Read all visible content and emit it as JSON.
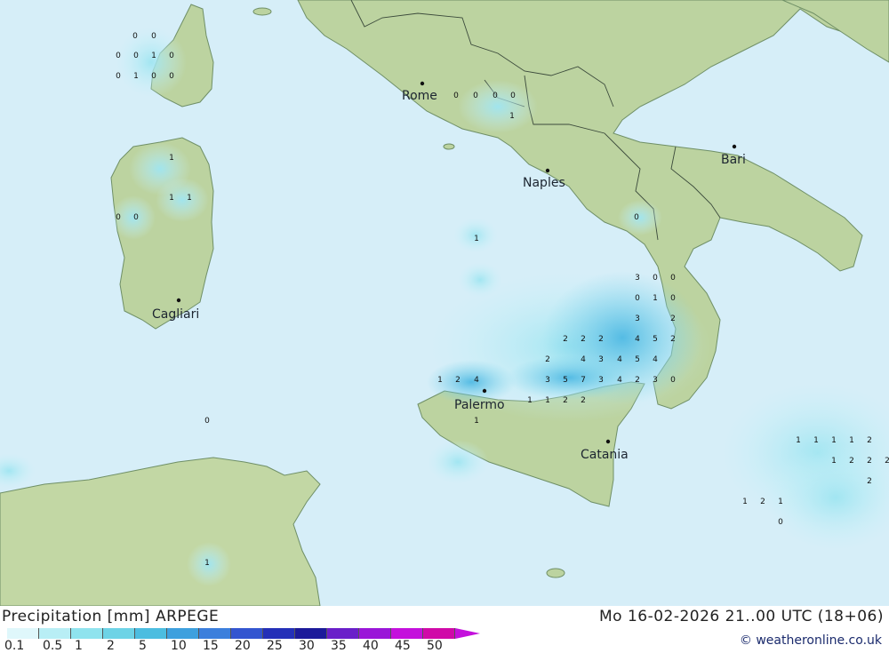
{
  "map": {
    "cities": [
      "Rome",
      "Naples",
      "Bari",
      "Cagliari",
      "Palermo",
      "Catania"
    ]
  },
  "values": [
    {
      "id": "v1",
      "t": "0"
    },
    {
      "id": "v2",
      "t": "0"
    },
    {
      "id": "v3",
      "t": "0"
    },
    {
      "id": "v4",
      "t": "0"
    },
    {
      "id": "v5",
      "t": "1"
    },
    {
      "id": "v6",
      "t": "0"
    },
    {
      "id": "v7",
      "t": "0"
    },
    {
      "id": "v8",
      "t": "1"
    },
    {
      "id": "v9",
      "t": "0"
    },
    {
      "id": "v10",
      "t": "0"
    },
    {
      "id": "v11",
      "t": "0"
    },
    {
      "id": "v12",
      "t": "0"
    },
    {
      "id": "v13",
      "t": "0"
    },
    {
      "id": "v14",
      "t": "0"
    },
    {
      "id": "v15",
      "t": "1"
    },
    {
      "id": "v16",
      "t": "1"
    },
    {
      "id": "v17",
      "t": "1"
    },
    {
      "id": "v18",
      "t": "1"
    },
    {
      "id": "v19",
      "t": "0"
    },
    {
      "id": "v20",
      "t": "0"
    },
    {
      "id": "v21",
      "t": "1"
    },
    {
      "id": "v22",
      "t": "0"
    },
    {
      "id": "v23",
      "t": "0"
    },
    {
      "id": "v24",
      "t": "0"
    },
    {
      "id": "v25",
      "t": "0"
    },
    {
      "id": "v26",
      "t": "1"
    },
    {
      "id": "v27",
      "t": "0"
    },
    {
      "id": "v28",
      "t": "2"
    },
    {
      "id": "v29",
      "t": "2"
    },
    {
      "id": "v30",
      "t": "2"
    },
    {
      "id": "v31",
      "t": "4"
    },
    {
      "id": "v32",
      "t": "5"
    },
    {
      "id": "v33",
      "t": "2"
    },
    {
      "id": "v34",
      "t": "2"
    },
    {
      "id": "v35",
      "t": "4"
    },
    {
      "id": "v36",
      "t": "3"
    },
    {
      "id": "v37",
      "t": "4"
    },
    {
      "id": "v38",
      "t": "5"
    },
    {
      "id": "v39",
      "t": "4"
    },
    {
      "id": "v40",
      "t": "1"
    },
    {
      "id": "v41",
      "t": "2"
    },
    {
      "id": "v42",
      "t": "4"
    },
    {
      "id": "v43",
      "t": "3"
    },
    {
      "id": "v44",
      "t": "5"
    },
    {
      "id": "v45",
      "t": "7"
    },
    {
      "id": "v46",
      "t": "3"
    },
    {
      "id": "v47",
      "t": "4"
    },
    {
      "id": "v48",
      "t": "2"
    },
    {
      "id": "v49",
      "t": "3"
    },
    {
      "id": "v50",
      "t": "0"
    },
    {
      "id": "v51",
      "t": "1"
    },
    {
      "id": "v52",
      "t": "1"
    },
    {
      "id": "v53",
      "t": "2"
    },
    {
      "id": "v54",
      "t": "2"
    },
    {
      "id": "v55",
      "t": "1"
    },
    {
      "id": "v56",
      "t": "1"
    },
    {
      "id": "v57",
      "t": "1"
    },
    {
      "id": "v58",
      "t": "1"
    },
    {
      "id": "v59",
      "t": "1"
    },
    {
      "id": "v60",
      "t": "2"
    },
    {
      "id": "v61",
      "t": "2"
    },
    {
      "id": "v62",
      "t": "2"
    },
    {
      "id": "v63",
      "t": "2"
    },
    {
      "id": "v64",
      "t": "2"
    },
    {
      "id": "v65",
      "t": "1"
    },
    {
      "id": "v66",
      "t": "2"
    },
    {
      "id": "v67",
      "t": "1"
    },
    {
      "id": "v68",
      "t": "0"
    },
    {
      "id": "v69",
      "t": "3"
    },
    {
      "id": "v70",
      "t": "3"
    },
    {
      "id": "v71",
      "t": "2"
    },
    {
      "id": "v72",
      "t": "1"
    },
    {
      "id": "v73",
      "t": "1"
    },
    {
      "id": "v74",
      "t": "0"
    }
  ],
  "legend": {
    "title": "Precipitation [mm] ARPEGE",
    "datetime": "Mo 16-02-2026 21..00 UTC (18+06)",
    "credit": "© weatheronline.co.uk",
    "ticks": [
      "0.1",
      "0.5",
      "1",
      "2",
      "5",
      "10",
      "15",
      "20",
      "25",
      "30",
      "35",
      "40",
      "45",
      "50"
    ],
    "colors": [
      "#dff7fb",
      "#b8eef5",
      "#8fe3ee",
      "#6dd3e6",
      "#4cbde0",
      "#3ea0de",
      "#3c7fdc",
      "#3355d0",
      "#2430b8",
      "#1c1a9a",
      "#6a1fc9",
      "#9a16d8",
      "#c410dc",
      "#d00aa8"
    ]
  }
}
